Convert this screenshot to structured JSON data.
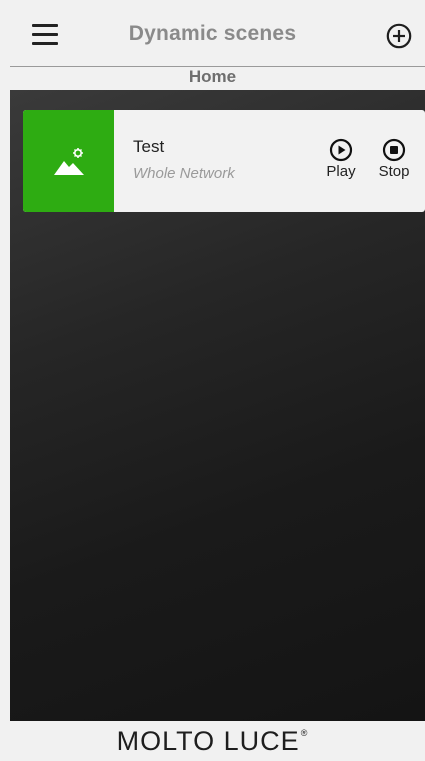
{
  "header": {
    "title": "Dynamic scenes",
    "menu_icon": "hamburger-menu-icon",
    "add_icon": "add-circle-icon"
  },
  "subheader": {
    "location": "Home"
  },
  "scenes": [
    {
      "name": "Test",
      "scope": "Whole Network",
      "thumbnail_icon": "landscape-gear-icon",
      "thumbnail_color": "#2eac12",
      "play_label": "Play",
      "stop_label": "Stop"
    }
  ],
  "footer": {
    "brand": "MOLTO LUCE",
    "registered_mark": "®"
  }
}
